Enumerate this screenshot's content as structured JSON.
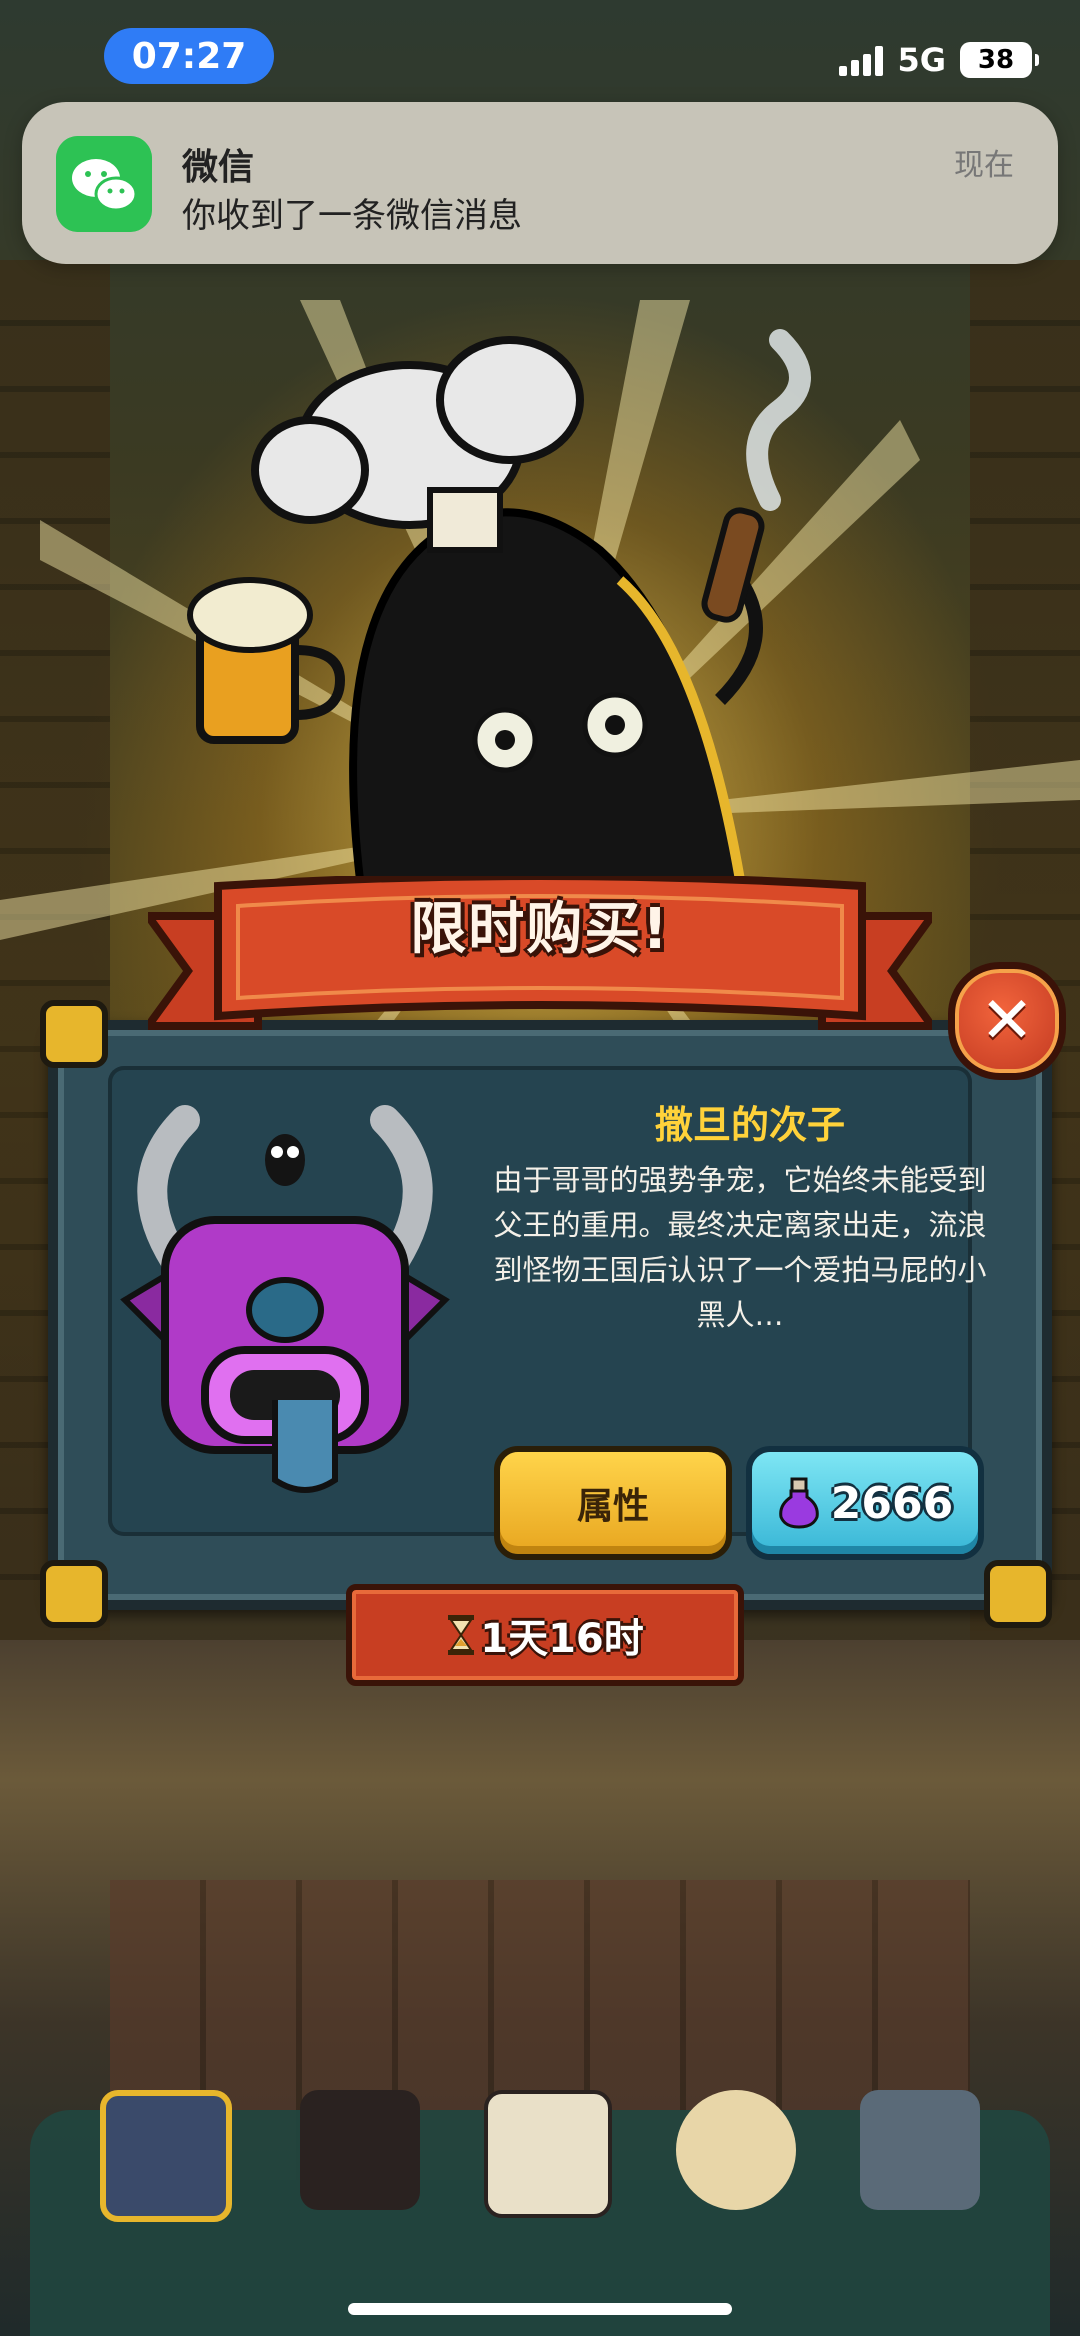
{
  "status_bar": {
    "time": "07:27",
    "network": "5G",
    "battery": "38"
  },
  "notification": {
    "app": "微信",
    "message": "你收到了一条微信消息",
    "time": "现在",
    "icon": "wechat-icon"
  },
  "offer": {
    "title": "限时购买!",
    "item_name": "撒旦的次子",
    "description": "由于哥哥的强势争宠，它始终未能受到父王的重用。最终决定离家出走，流浪到怪物王国后认识了一个爱拍马屁的小黑人…",
    "attributes_button": "属性",
    "price": "2666",
    "price_icon": "purple-potion-icon",
    "timer": "1天16时",
    "timer_icon": "hourglass-icon",
    "close_icon": "close-icon"
  },
  "bottom_nav": {
    "items": [
      "building-icon",
      "monster-icon",
      "book-icon",
      "money-bag-icon",
      "grid-icon"
    ]
  },
  "colors": {
    "banner": "#c83e22",
    "item_name": "#ffd23a",
    "attr_button": "#ffd44a",
    "price_button": "#7ee6f4"
  }
}
